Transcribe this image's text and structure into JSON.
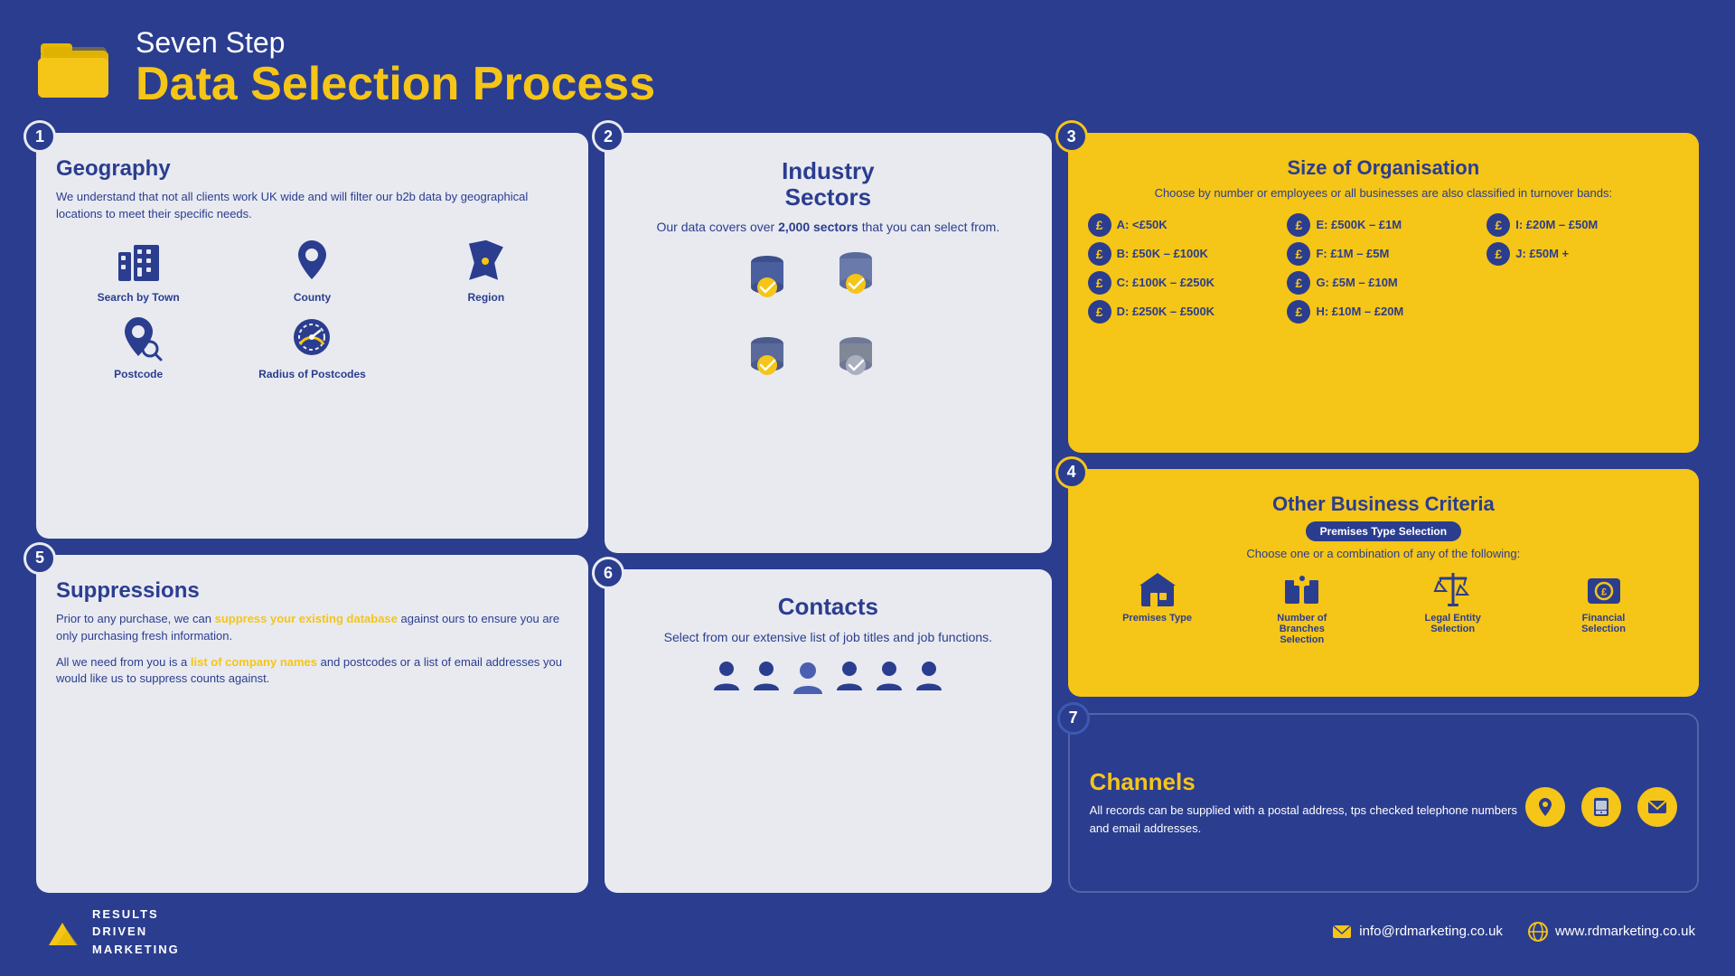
{
  "header": {
    "subtitle": "Seven Step",
    "title": "Data Selection Process"
  },
  "step1": {
    "number": "1",
    "title": "Geography",
    "body": "We understand that not all clients work UK wide and will filter our b2b data by geographical locations to meet their specific needs.",
    "icons": [
      {
        "label": "Search by Town",
        "type": "building"
      },
      {
        "label": "County",
        "type": "pin"
      },
      {
        "label": "Region",
        "type": "region"
      },
      {
        "label": "Postcode",
        "type": "postcode"
      },
      {
        "label": "Radius of Postcodes",
        "type": "radius"
      }
    ]
  },
  "step2": {
    "number": "2",
    "title": "Industry Sectors",
    "body_prefix": "Our data covers over ",
    "body_highlight": "2,000 sectors",
    "body_suffix": " that you can select from."
  },
  "step3": {
    "number": "3",
    "title": "Size of Organisation",
    "subtitle": "Choose by number or employees or all businesses are also classified in turnover bands:",
    "bands": [
      {
        "label": "A: <£50K"
      },
      {
        "label": "E: £500K – £1M"
      },
      {
        "label": "I: £20M – £50M"
      },
      {
        "label": "B: £50K – £100K"
      },
      {
        "label": "F: £1M – £5M"
      },
      {
        "label": "J: £50M +"
      },
      {
        "label": "C: £100K – £250K"
      },
      {
        "label": "G: £5M – £10M"
      },
      {
        "label": ""
      },
      {
        "label": "D: £250K – £500K"
      },
      {
        "label": "H: £10M – £20M"
      },
      {
        "label": ""
      }
    ]
  },
  "step4": {
    "number": "4",
    "title": "Other Business Criteria",
    "pill": "Premises Type Selection",
    "subtitle": "Choose one or a combination of any of the following:",
    "items": [
      {
        "label": "Premises Type",
        "type": "building"
      },
      {
        "label": "Number of Branches Selection",
        "type": "branches"
      },
      {
        "label": "Legal Entity Selection",
        "type": "legal"
      },
      {
        "label": "Financial Selection",
        "type": "financial"
      }
    ]
  },
  "step5": {
    "number": "5",
    "title": "Suppressions",
    "body1": "Prior to any purchase, we can ",
    "body1_highlight": "suppress your existing database",
    "body1_suffix": " against ours to ensure you are only purchasing fresh information.",
    "body2_prefix": "All we need from you is a ",
    "body2_highlight": "list of company names",
    "body2_suffix": " and postcodes or a list of email addresses you would like us to suppress counts against."
  },
  "step6": {
    "number": "6",
    "title": "Contacts",
    "body": "Select from our extensive list of job titles and job functions."
  },
  "step7": {
    "number": "7",
    "title": "Channels",
    "body": "All records can be supplied with a postal address, tps checked telephone numbers and email addresses."
  },
  "footer": {
    "logo_lines": [
      "RESULTS",
      "DRIVEN",
      "MARKETING"
    ],
    "email": "info@rdmarketing.co.uk",
    "website": "www.rdmarketing.co.uk"
  }
}
